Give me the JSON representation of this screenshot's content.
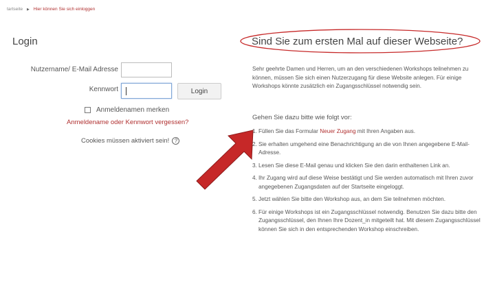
{
  "breadcrumb": {
    "home": "tartseite",
    "current": "Hier können Sie sich einloggen"
  },
  "login": {
    "title": "Login",
    "username_label": "Nutzername/ E-Mail Adresse",
    "username_value": "",
    "password_label": "Kennwort",
    "password_value": "",
    "button": "Login",
    "remember_label": "Anmeldenamen merken",
    "remember_checked": false,
    "forgot_link": "Anmeldename oder Kennwort vergessen?",
    "cookies_text": "Cookies müssen aktiviert sein!"
  },
  "first_visit": {
    "title": "Sind Sie zum ersten Mal auf dieser Webseite?",
    "intro": "Sehr geehrte Damen und Herren, um an den verschiedenen Workshops teilnehmen zu können, müssen Sie sich einen Nutzerzugang für diese Website anlegen. Für einige Workshops könnte zusätzlich ein Zugangsschlüssel notwendig sein.",
    "steps_lead": "Gehen Sie dazu bitte wie folgt vor:",
    "steps": [
      {
        "num": "1.",
        "before": "Füllen Sie das Formular ",
        "link": "Neuer Zugang",
        "after": " mit Ihren Angaben aus."
      },
      {
        "num": "2.",
        "text": "Sie erhalten umgehend eine Benachrichtigung an die von Ihnen angegebene E-Mail-Adresse."
      },
      {
        "num": "3.",
        "text": "Lesen Sie diese E-Mail genau und klicken Sie den darin enthaltenen Link an."
      },
      {
        "num": "4.",
        "text": "Ihr Zugang wird auf diese Weise bestätigt und Sie werden automatisch mit Ihren zuvor angegebenen Zugangsdaten auf der Startseite eingeloggt."
      },
      {
        "num": "5.",
        "text": "Jetzt wählen Sie bitte den Workshop aus, an dem Sie teilnehmen möchten."
      },
      {
        "num": "6.",
        "text": "Für einige Workshops ist ein Zugangsschlüssel notwendig. Benutzen Sie dazu bitte den Zugangsschlüssel, den Ihnen Ihre Dozent_in mitgeteilt hat. Mit diesem Zugangsschlüssel können Sie sich in den entsprechenden Workshop einschreiben."
      }
    ]
  },
  "icons": {
    "breadcrumb_separator": "triangle-right-icon",
    "help": "question-circle-icon",
    "annotation_arrow": "red-arrow-icon"
  },
  "colors": {
    "link": "#b03030",
    "annotation": "#c62828"
  }
}
